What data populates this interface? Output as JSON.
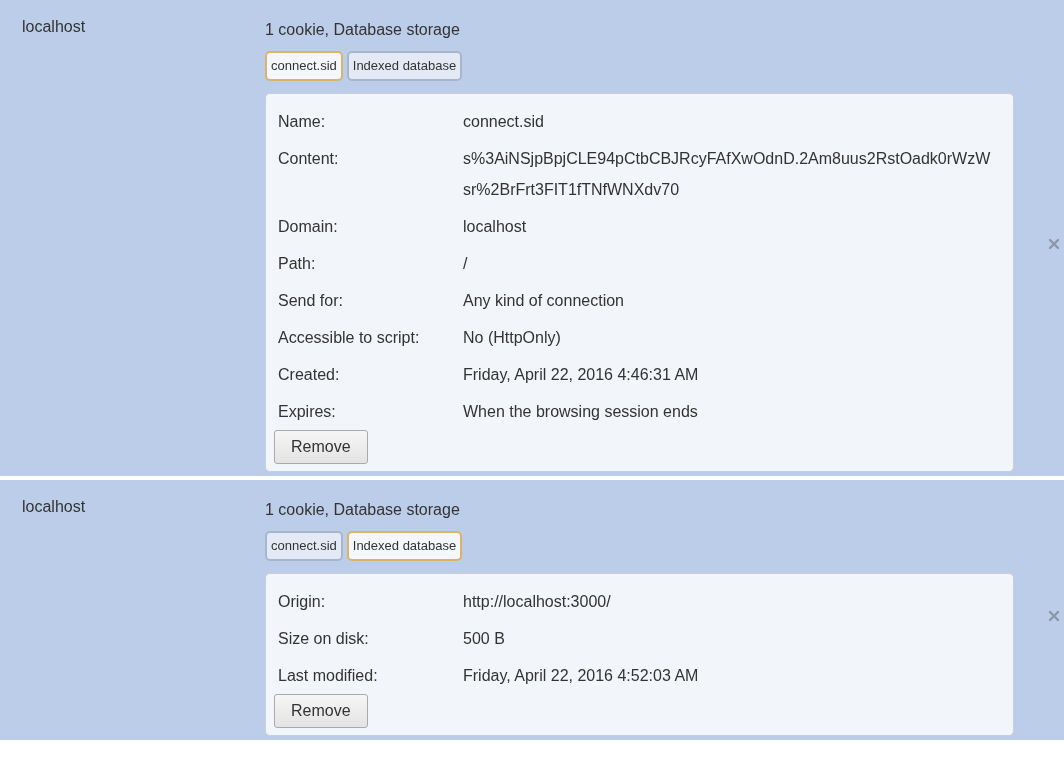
{
  "sites": [
    {
      "site": "localhost",
      "summary": "1 cookie, Database storage",
      "items": [
        {
          "label": "connect.sid",
          "selected": true
        },
        {
          "label": "Indexed database",
          "selected": false
        }
      ],
      "details": [
        {
          "label": "Name:",
          "value": "connect.sid"
        },
        {
          "label": "Content:",
          "value": "s%3AiNSjpBpjCLE94pCtbCBJRcyFAfXwOdnD.2Am8uus2RstOadk0rWzWsr%2BrFrt3FIT1fTNfWNXdv70"
        },
        {
          "label": "Domain:",
          "value": "localhost"
        },
        {
          "label": "Path:",
          "value": "/"
        },
        {
          "label": "Send for:",
          "value": "Any kind of connection"
        },
        {
          "label": "Accessible to script:",
          "value": "No (HttpOnly)"
        },
        {
          "label": "Created:",
          "value": "Friday, April 22, 2016 4:46:31 AM"
        },
        {
          "label": "Expires:",
          "value": "When the browsing session ends"
        }
      ],
      "button": "Remove"
    },
    {
      "site": "localhost",
      "summary": "1 cookie, Database storage",
      "items": [
        {
          "label": "connect.sid",
          "selected": false
        },
        {
          "label": "Indexed database",
          "selected": true
        }
      ],
      "details": [
        {
          "label": "Origin:",
          "value": "http://localhost:3000/"
        },
        {
          "label": "Size on disk:",
          "value": "500 B"
        },
        {
          "label": "Last modified:",
          "value": "Friday, April 22, 2016 4:52:03 AM"
        }
      ],
      "button": "Remove"
    }
  ]
}
